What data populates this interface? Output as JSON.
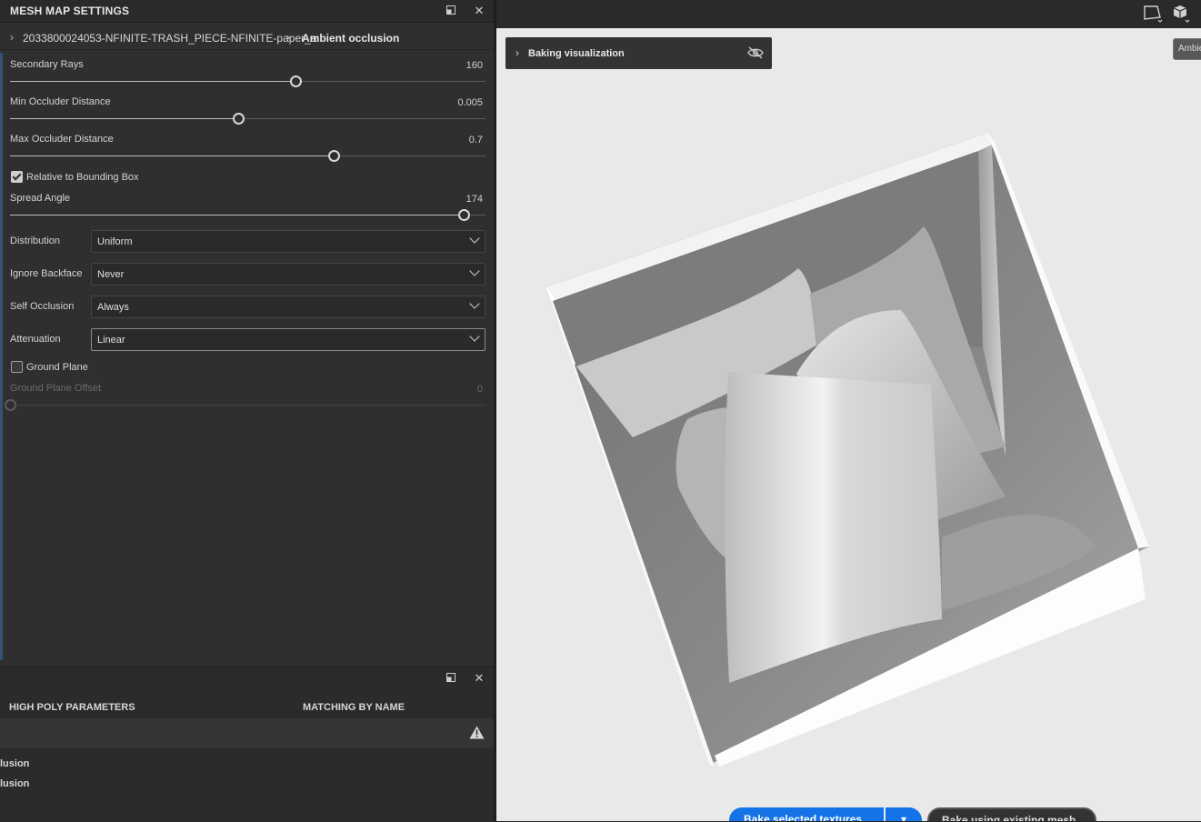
{
  "panel": {
    "title": "MESH MAP SETTINGS",
    "breadcrumb": {
      "asset": "2033800024053-NFINITE-TRASH_PIECE-NFINITE-paper_a",
      "current": "Ambient occlusion"
    }
  },
  "settings": {
    "secondary_rays": {
      "label": "Secondary Rays",
      "value": "160",
      "fraction": 0.6
    },
    "min_occluder": {
      "label": "Min Occluder Distance",
      "value": "0.005",
      "fraction": 0.48
    },
    "max_occluder": {
      "label": "Max Occluder Distance",
      "value": "0.7",
      "fraction": 0.68
    },
    "relative_bbox": {
      "label": "Relative to Bounding Box",
      "checked": true
    },
    "spread_angle": {
      "label": "Spread Angle",
      "value": "174",
      "fraction": 0.955
    },
    "distribution": {
      "label": "Distribution",
      "value": "Uniform"
    },
    "ignore_backface": {
      "label": "Ignore Backface",
      "value": "Never"
    },
    "self_occlusion": {
      "label": "Self Occlusion",
      "value": "Always"
    },
    "attenuation": {
      "label": "Attenuation",
      "value": "Linear"
    },
    "ground_plane": {
      "label": "Ground Plane",
      "checked": false
    },
    "ground_plane_offset": {
      "label": "Ground Plane Offset",
      "value": "0",
      "fraction": 0
    }
  },
  "panel2": {
    "col1": "HIGH POLY PARAMETERS",
    "col2": "MATCHING BY NAME",
    "items": [
      "lusion",
      "lusion"
    ]
  },
  "viewport": {
    "baking_visualization": "Baking visualization",
    "ambient_tag": "Ambient occlusion",
    "bake_button": "Bake selected textures",
    "bake_options": "▾",
    "bake_keep": "Bake using existing mesh"
  }
}
